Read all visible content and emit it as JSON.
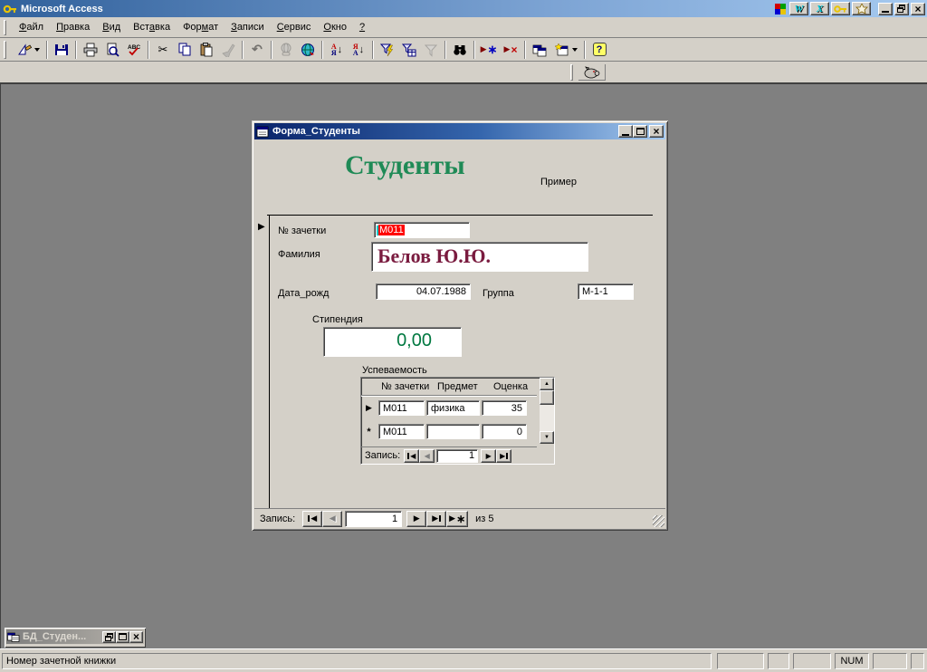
{
  "app": {
    "title": "Microsoft Access"
  },
  "office_bar": {
    "icons": [
      "office-logo",
      "word",
      "excel",
      "access-key",
      "office-app"
    ]
  },
  "menu": {
    "items": [
      {
        "pre": "",
        "key": "Ф",
        "post": "айл"
      },
      {
        "pre": "",
        "key": "П",
        "post": "равка"
      },
      {
        "pre": "",
        "key": "В",
        "post": "ид"
      },
      {
        "pre": "Вст",
        "key": "а",
        "post": "вка"
      },
      {
        "pre": "Фор",
        "key": "м",
        "post": "ат"
      },
      {
        "pre": "",
        "key": "З",
        "post": "аписи"
      },
      {
        "pre": "",
        "key": "С",
        "post": "ервис"
      },
      {
        "pre": "",
        "key": "О",
        "post": "кно"
      },
      {
        "pre": "",
        "key": "?",
        "post": ""
      }
    ]
  },
  "toolbar": {
    "buttons": [
      "view-design",
      "save",
      "print",
      "print-preview",
      "spelling",
      "cut",
      "copy",
      "paste",
      "format-painter",
      "undo",
      "insert-hyperlink",
      "web-toolbar",
      "sort-ascending",
      "sort-descending",
      "filter-by-selection",
      "filter-by-form",
      "apply-filter",
      "find",
      "new-record",
      "delete-record",
      "database-window",
      "new-object",
      "help"
    ],
    "disabled_buttons": [
      "format-painter",
      "undo",
      "insert-hyperlink",
      "apply-filter"
    ]
  },
  "custom_toolbar": {
    "icons": [
      "pig"
    ]
  },
  "form_window": {
    "title": "Форма_Студенты",
    "header": {
      "title": "Студенты",
      "note": "Пример"
    },
    "fields": {
      "record_number": {
        "label": "№ зачетки",
        "value": "М011"
      },
      "surname": {
        "label": "Фамилия",
        "value": "Белов Ю.Ю."
      },
      "birth_date": {
        "label": "Дата_рожд",
        "value": "04.07.1988"
      },
      "group": {
        "label": "Группа",
        "value": "М-1-1"
      },
      "stipend": {
        "label": "Стипендия",
        "value": "0,00"
      }
    },
    "subform": {
      "label": "Успеваемость",
      "columns": [
        "№ зачетки",
        "Предмет",
        "Оценка"
      ],
      "rows": [
        {
          "cells": [
            "М011",
            "физика",
            "35"
          ]
        },
        {
          "cells": [
            "М011",
            "",
            "0"
          ]
        }
      ],
      "new_row_marker": "*",
      "nav": {
        "label": "Запись:",
        "current": "1"
      }
    },
    "nav": {
      "label": "Запись:",
      "current": "1",
      "total": "из 5"
    }
  },
  "minimized_window": {
    "title": "БД_Студен..."
  },
  "status_bar": {
    "message": "Номер зачетной книжки",
    "num": "NUM"
  },
  "colors": {
    "header_title": "#1f8a56",
    "surname": "#7a1b3f",
    "stipend_value": "#007840",
    "selection_bg": "#ff0000",
    "title_gradient_start": "#0a246a",
    "title_gradient_end": "#a6caf0",
    "mdi_background": "#808080",
    "chrome": "#d4d0c8"
  }
}
